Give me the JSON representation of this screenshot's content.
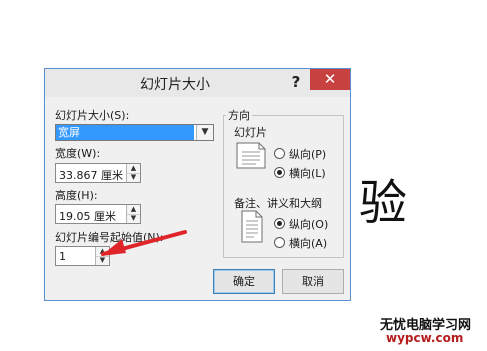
{
  "dialog": {
    "title": "幻灯片大小",
    "help_label": "?",
    "close_label": "✕",
    "slide_size": {
      "label": "幻灯片大小(S):",
      "value": "宽屏",
      "arrow_icon": "chevron-down-icon"
    },
    "width": {
      "label": "宽度(W):",
      "value": "33.867 厘米"
    },
    "height": {
      "label": "高度(H):",
      "value": "19.05 厘米"
    },
    "numbering": {
      "label": "幻灯片编号起始值(N):",
      "value": "1"
    },
    "orientation": {
      "title": "方向",
      "slides": {
        "title": "幻灯片",
        "portrait": "纵向(P)",
        "landscape": "横向(L)",
        "selected": "landscape"
      },
      "notes": {
        "title": "备注、讲义和大纲",
        "portrait": "纵向(O)",
        "landscape": "横向(A)",
        "selected": "portrait"
      }
    },
    "ok_label": "确定",
    "cancel_label": "取消",
    "spin_up": "▲",
    "spin_down": "▼"
  },
  "overlay": {
    "big_char": "验",
    "watermark_text": "无忧电脑学习网",
    "watermark_url": "wypcw.com",
    "arrow_color": "#e0252a"
  },
  "colors": {
    "close_button": "#c74141",
    "selection": "#3399ff",
    "dialog_border": "#5b8fcf"
  }
}
